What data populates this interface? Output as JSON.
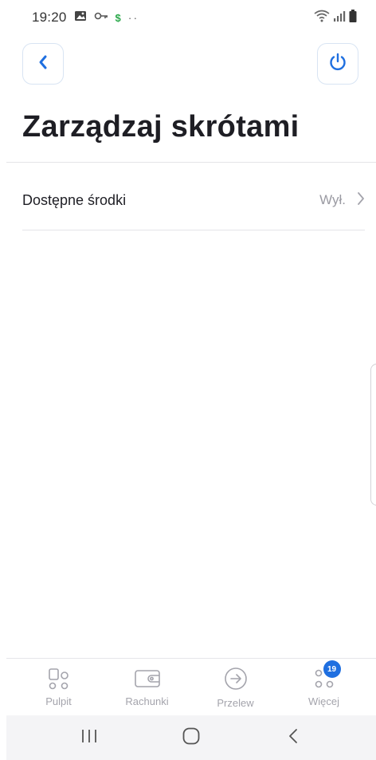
{
  "status_bar": {
    "time": "19:20",
    "left_icons": [
      "image-icon",
      "key-icon",
      "dollar-icon",
      "more-dots-icon"
    ],
    "right_icons": [
      "wifi-icon",
      "signal-icon",
      "battery-icon"
    ],
    "dollar_symbol": "$",
    "dots": "··"
  },
  "header": {
    "back_icon": "chevron-left-icon",
    "power_icon": "power-icon",
    "accent_color": "#1f6fe0"
  },
  "page": {
    "title": "Zarządzaj skrótami"
  },
  "settings": {
    "items": [
      {
        "label": "Dostępne środki",
        "value": "Wył."
      }
    ]
  },
  "bottom_nav": {
    "items": [
      {
        "label": "Pulpit",
        "icon": "dashboard-icon"
      },
      {
        "label": "Rachunki",
        "icon": "wallet-icon"
      },
      {
        "label": "Przelew",
        "icon": "transfer-icon"
      },
      {
        "label": "Więcej",
        "icon": "more-icon",
        "badge": "19"
      }
    ]
  },
  "system_nav": {
    "buttons": [
      "recents-icon",
      "home-icon",
      "back-icon"
    ]
  }
}
